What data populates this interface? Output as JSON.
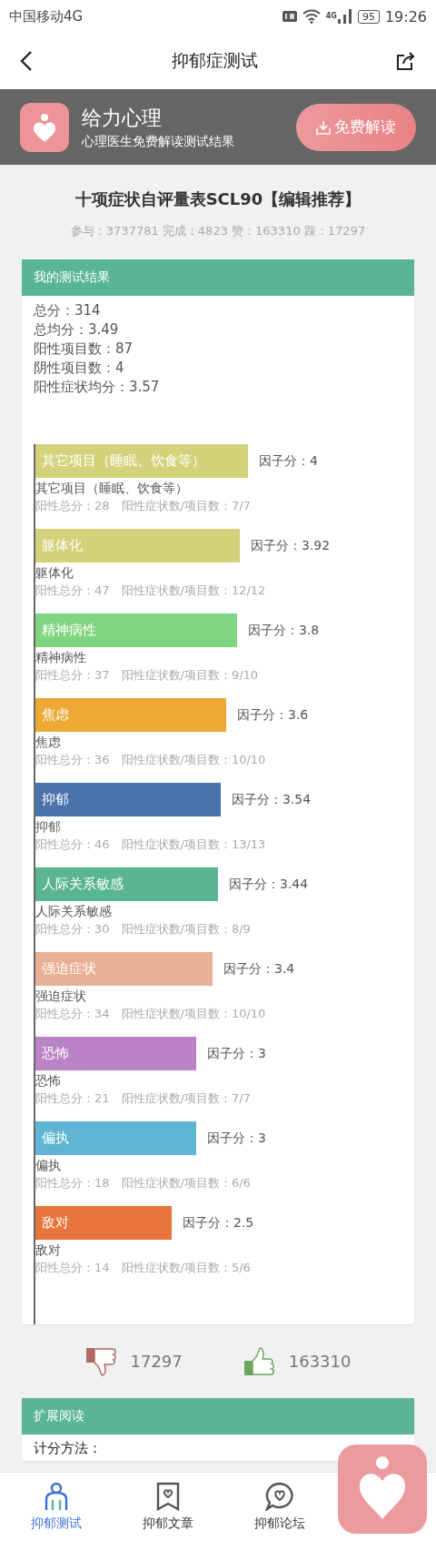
{
  "status_bar": {
    "carrier": "中国移动4G",
    "signal_label": "4G",
    "battery": "95",
    "time": "19:26"
  },
  "nav": {
    "title": "抑郁症测试"
  },
  "banner": {
    "title": "给力心理",
    "subtitle": "心理医生免费解读测试结果",
    "button": "免费解读"
  },
  "test": {
    "title": "十项症状自评量表SCL90【编辑推荐】",
    "stats": "参与：3737781 完成：4823 赞：163310 踩：17297"
  },
  "result": {
    "header": "我的测试结果",
    "summary": [
      "总分：314",
      "总均分：3.49",
      "阳性项目数：87",
      "阴性项目数：4",
      "阳性症状均分：3.57"
    ],
    "factors": [
      {
        "bar_label": "其它项目（睡眠、饮食等）",
        "name": "其它项目（睡眠、饮食等）",
        "score": "因子分：4",
        "detail": "阳性总分：28　阳性症状数/项目数：7/7",
        "level": 0.78,
        "color": "#d3d27a"
      },
      {
        "bar_label": "躯体化",
        "name": "躯体化",
        "score": "因子分：3.92",
        "detail": "阳性总分：47　阳性症状数/项目数：12/12",
        "level": 0.75,
        "color": "#d3d27a"
      },
      {
        "bar_label": "精神病性",
        "name": "精神病性",
        "score": "因子分：3.8",
        "detail": "阳性总分：37　阳性症状数/项目数：9/10",
        "level": 0.74,
        "color": "#80d580"
      },
      {
        "bar_label": "焦虑",
        "name": "焦虑",
        "score": "因子分：3.6",
        "detail": "阳性总分：36　阳性症状数/项目数：10/10",
        "level": 0.7,
        "color": "#ecaa35"
      },
      {
        "bar_label": "抑郁",
        "name": "抑郁",
        "score": "因子分：3.54",
        "detail": "阳性总分：46　阳性症状数/项目数：13/13",
        "level": 0.68,
        "color": "#4a72ad"
      },
      {
        "bar_label": "人际关系敏感",
        "name": "人际关系敏感",
        "score": "因子分：3.44",
        "detail": "阳性总分：30　阳性症状数/项目数：8/9",
        "level": 0.67,
        "color": "#5ab591"
      },
      {
        "bar_label": "强迫症状",
        "name": "强迫症状",
        "score": "因子分：3.4",
        "detail": "阳性总分：34　阳性症状数/项目数：10/10",
        "level": 0.65,
        "color": "#eab096"
      },
      {
        "bar_label": "恐怖",
        "name": "恐怖",
        "score": "因子分：3",
        "detail": "阳性总分：21　阳性症状数/项目数：7/7",
        "level": 0.59,
        "color": "#b983c6"
      },
      {
        "bar_label": "偏执",
        "name": "偏执",
        "score": "因子分：3",
        "detail": "阳性总分：18　阳性症状数/项目数：6/6",
        "level": 0.59,
        "color": "#5fb5d3"
      },
      {
        "bar_label": "敌对",
        "name": "敌对",
        "score": "因子分：2.5",
        "detail": "阳性总分：14　阳性症状数/项目数：5/6",
        "level": 0.5,
        "color": "#e8753c"
      }
    ]
  },
  "votes": {
    "dislikes": "17297",
    "likes": "163310"
  },
  "reading": {
    "header": "扩展阅读",
    "text": "计分方法："
  },
  "tabs": [
    {
      "label": "抑郁测试",
      "kind": "person",
      "selected": true
    },
    {
      "label": "抑郁文章",
      "kind": "article",
      "selected": false
    },
    {
      "label": "抑郁论坛",
      "kind": "chat",
      "selected": false
    }
  ]
}
